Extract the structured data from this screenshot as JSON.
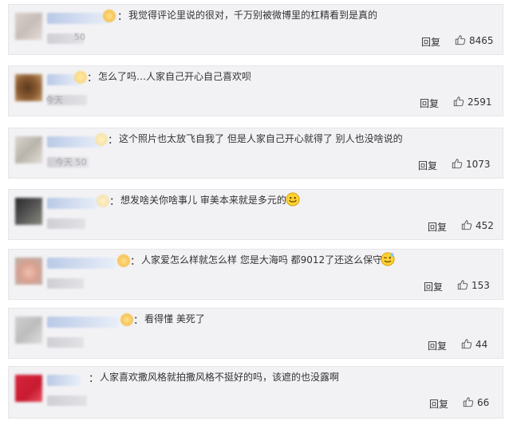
{
  "comments": [
    {
      "text": "我觉得评论里说的很对，千万别被微博里的杠精看到是真的",
      "time_fragment": "50",
      "reply_label": "回复",
      "likes": "8465"
    },
    {
      "text": "怎么了吗…人家自己开心自己喜欢呗",
      "time_fragment": "今天",
      "reply_label": "回复",
      "likes": "2591"
    },
    {
      "text": "这个照片也太放飞自我了 但是人家自己开心就得了 别人也没啥说的",
      "time_fragment": "今天 50",
      "reply_label": "回复",
      "likes": "1073"
    },
    {
      "text": "想发啥关你啥事儿 审美本来就是多元的",
      "time_fragment": "",
      "reply_label": "回复",
      "likes": "452",
      "emoji": "smile"
    },
    {
      "text": "人家爱怎么样就怎么样 您是大海吗 都9012了还这么保守吗",
      "time_fragment": "",
      "reply_label": "回复",
      "likes": "153",
      "emoji": "wink"
    },
    {
      "text": "看得懂 美死了",
      "time_fragment": "",
      "reply_label": "回复",
      "likes": "44"
    },
    {
      "text": "人家喜欢撒风格就拍撒风格不挺好的吗，该遮的也没露啊",
      "time_fragment": "",
      "reply_label": "回复",
      "likes": "66"
    }
  ]
}
